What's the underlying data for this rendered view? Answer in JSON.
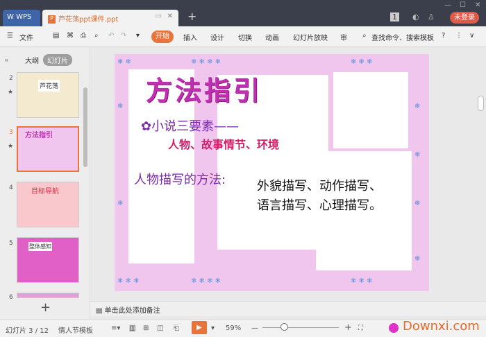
{
  "titlebar": {
    "wps_label": "WPS",
    "doc_tab": "芦花荡ppt课件.ppt",
    "login": "未登录",
    "badge": "1"
  },
  "toolbar": {
    "file": "文件",
    "start": "开始",
    "tabs": [
      "插入",
      "设计",
      "切换",
      "动画",
      "幻灯片放映",
      "审"
    ],
    "search": "查找命令、搜索模板",
    "help": "?"
  },
  "sidebar": {
    "tab_outline": "大纲",
    "tab_slides": "幻灯片",
    "slides": [
      {
        "num": "2",
        "title": "芦花荡"
      },
      {
        "num": "3",
        "title": "方法指引"
      },
      {
        "num": "4",
        "title": "目标导航"
      },
      {
        "num": "5",
        "title": "整体感知"
      },
      {
        "num": "6",
        "title": ""
      }
    ],
    "add": "+"
  },
  "slide": {
    "title": "方法指引",
    "subtitle": "小说三要素——",
    "elements": "人物、故事情节、环境",
    "method_label": "人物描写的方法:",
    "method_desc": "外貌描写、动作描写、语言描写、心理描写。"
  },
  "notes": {
    "placeholder": "单击此处添加备注"
  },
  "status": {
    "slide_counter": "幻灯片 3 / 12",
    "template": "情人节模板",
    "zoom": "59%",
    "watermark": "Downxi.com"
  },
  "colors": {
    "accent": "#e8743b",
    "title": "#c02fb0",
    "slide_bg": "#f1c6ee"
  }
}
